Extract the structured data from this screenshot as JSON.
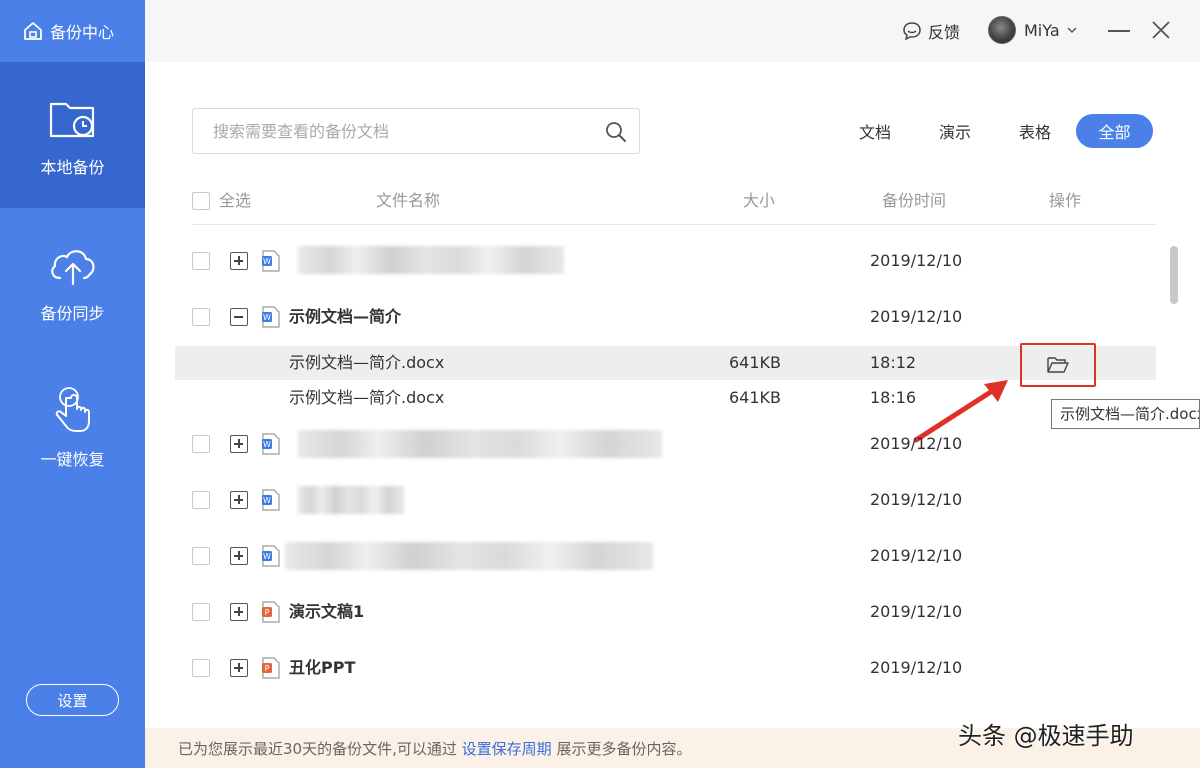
{
  "app": {
    "title": "备份中心"
  },
  "sidebar": {
    "items": [
      {
        "label": "本地备份",
        "icon": "folder-clock-icon",
        "active": true
      },
      {
        "label": "备份同步",
        "icon": "cloud-upload-icon",
        "active": false
      },
      {
        "label": "一键恢复",
        "icon": "hand-pointer-icon",
        "active": false
      }
    ],
    "settings_label": "设置"
  },
  "topbar": {
    "feedback_label": "反馈",
    "username": "MiYa"
  },
  "search": {
    "placeholder": "搜索需要查看的备份文档"
  },
  "filters": [
    {
      "label": "文档",
      "active": false
    },
    {
      "label": "演示",
      "active": false
    },
    {
      "label": "表格",
      "active": false
    },
    {
      "label": "全部",
      "active": true
    }
  ],
  "table": {
    "headers": {
      "select_all": "全选",
      "name": "文件名称",
      "size": "大小",
      "time": "备份时间",
      "action": "操作"
    },
    "rows": [
      {
        "name": "",
        "date": "2019/12/10",
        "type": "word",
        "expanded": false,
        "blurred": true
      },
      {
        "name": "示例文档—简介",
        "date": "2019/12/10",
        "type": "word",
        "expanded": true,
        "blurred": false
      },
      {
        "name": "",
        "date": "2019/12/10",
        "type": "word",
        "expanded": false,
        "blurred": true
      },
      {
        "name": "",
        "date": "2019/12/10",
        "type": "word",
        "expanded": false,
        "blurred": true
      },
      {
        "name": "",
        "date": "2019/12/10",
        "type": "word",
        "expanded": false,
        "blurred": true
      },
      {
        "name": "演示文稿1",
        "date": "2019/12/10",
        "type": "ppt",
        "expanded": false,
        "blurred": false
      },
      {
        "name": "丑化PPT",
        "date": "2019/12/10",
        "type": "ppt",
        "expanded": false,
        "blurred": false
      }
    ],
    "sub_rows": [
      {
        "name": "示例文档—简介.docx",
        "size": "641KB",
        "time": "18:12",
        "highlighted": true
      },
      {
        "name": "示例文档—简介.docx",
        "size": "641KB",
        "time": "18:16",
        "highlighted": false
      }
    ]
  },
  "tooltip": {
    "text": "示例文档—简介.docx"
  },
  "footer": {
    "prefix": "已为您展示最近30天的备份文件,可以通过",
    "link": "设置保存周期",
    "suffix": "展示更多备份内容。"
  },
  "watermark": "头条 @极速手助",
  "colors": {
    "sidebar": "#4a80e8",
    "sidebar_active": "#3567cf",
    "accent": "#4a80e8",
    "highlight_border": "#e0302a",
    "footer_bg": "#fbf1e6"
  }
}
